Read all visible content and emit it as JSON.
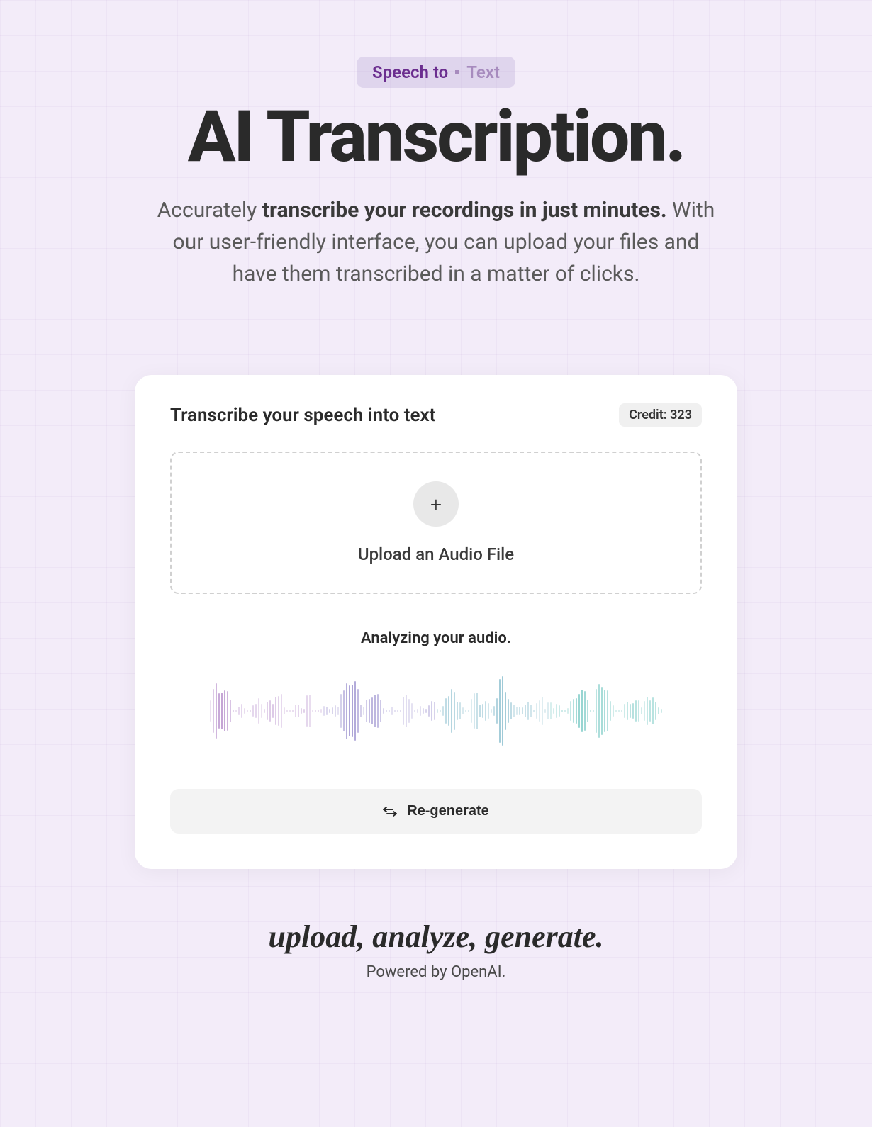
{
  "hero": {
    "badge_prefix": "Speech to",
    "badge_suffix": "Text",
    "title": "AI Transcription.",
    "desc_prefix": "Accurately ",
    "desc_bold": "transcribe your recordings in just minutes.",
    "desc_suffix": " With our user-friendly interface, you can upload your files and have them transcribed in a matter of clicks."
  },
  "card": {
    "title": "Transcribe your speech into text",
    "credit_label": "Credit: 323",
    "upload_label": "Upload an Audio File",
    "analyzing_label": "Analyzing your audio.",
    "regenerate_label": "Re-generate"
  },
  "footer": {
    "tagline": "upload, analyze, generate.",
    "powered": "Powered by OpenAI."
  },
  "waveform": {
    "bars": 160,
    "colors": [
      "#b48ac9",
      "#9a8fce",
      "#7fb8c9",
      "#6fc5c0"
    ]
  }
}
